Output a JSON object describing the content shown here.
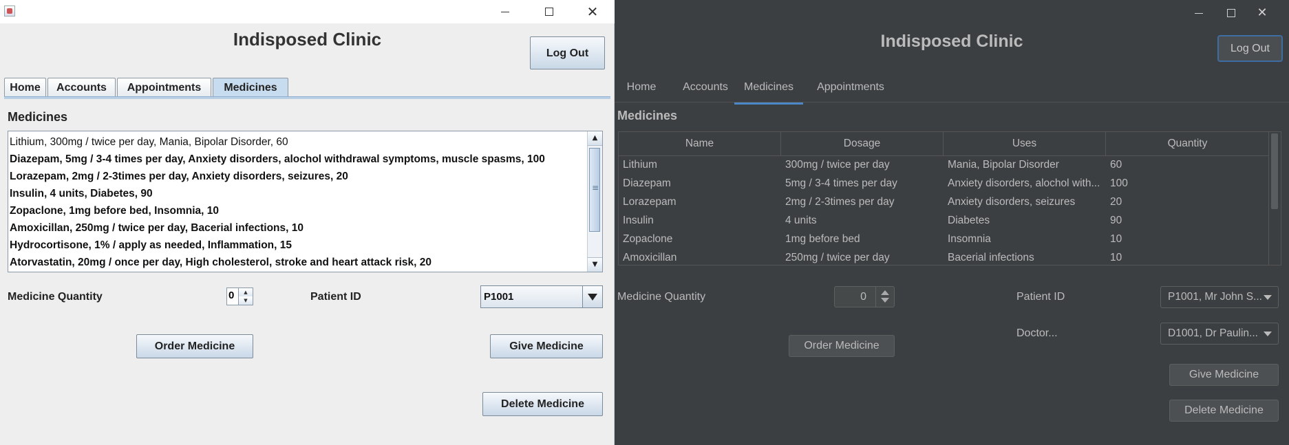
{
  "light_window": {
    "title": "Indisposed Clinic",
    "logout_label": "Log Out",
    "tabs": [
      {
        "label": "Home"
      },
      {
        "label": "Accounts"
      },
      {
        "label": "Appointments"
      },
      {
        "label": "Medicines"
      }
    ],
    "active_tab": "Medicines",
    "section_title": "Medicines",
    "medicines_list": [
      "Lithium, 300mg / twice per day, Mania, Bipolar Disorder, 60",
      "Diazepam, 5mg / 3-4 times per day, Anxiety disorders, alochol withdrawal symptoms, muscle spasms, 100",
      "Lorazepam, 2mg / 2-3times per day, Anxiety disorders, seizures, 20",
      "Insulin, 4 units, Diabetes, 90",
      "Zopaclone, 1mg before bed, Insomnia, 10",
      "Amoxicillan, 250mg / twice per day, Bacerial infections, 10",
      "Hydrocortisone, 1% / apply as needed, Inflammation, 15",
      "Atorvastatin, 20mg / once per day, High cholesterol, stroke and heart attack risk, 20"
    ],
    "quantity_label": "Medicine Quantity",
    "quantity_value": "0",
    "patient_label": "Patient ID",
    "patient_value": "P1001",
    "order_button": "Order Medicine",
    "give_button": "Give Medicine",
    "delete_button": "Delete Medicine"
  },
  "dark_window": {
    "title": "Indisposed Clinic",
    "logout_label": "Log Out",
    "tabs": [
      {
        "label": "Home"
      },
      {
        "label": "Accounts"
      },
      {
        "label": "Medicines"
      },
      {
        "label": "Appointments"
      }
    ],
    "active_tab": "Medicines",
    "section_title": "Medicines",
    "table": {
      "columns": [
        "Name",
        "Dosage",
        "Uses",
        "Quantity"
      ],
      "rows": [
        {
          "name": "Lithium",
          "dosage": "300mg / twice per day",
          "uses": "Mania, Bipolar Disorder",
          "quantity": "60"
        },
        {
          "name": "Diazepam",
          "dosage": "5mg / 3-4 times per day",
          "uses": "Anxiety disorders, alochol with...",
          "quantity": "100"
        },
        {
          "name": "Lorazepam",
          "dosage": "2mg / 2-3times per day",
          "uses": "Anxiety disorders, seizures",
          "quantity": "20"
        },
        {
          "name": "Insulin",
          "dosage": "4 units",
          "uses": "Diabetes",
          "quantity": "90"
        },
        {
          "name": "Zopaclone",
          "dosage": "1mg before bed",
          "uses": "Insomnia",
          "quantity": "10"
        },
        {
          "name": "Amoxicillan",
          "dosage": "250mg / twice per day",
          "uses": "Bacerial infections",
          "quantity": "10"
        }
      ]
    },
    "quantity_label": "Medicine Quantity",
    "quantity_value": "0",
    "patient_label": "Patient ID",
    "patient_value": "P1001, Mr John S...",
    "doctor_label": "Doctor...",
    "doctor_value": "D1001, Dr Paulin...",
    "order_button": "Order Medicine",
    "give_button": "Give Medicine",
    "delete_button": "Delete Medicine"
  },
  "colors": {
    "light_bg": "#eeeeee",
    "light_accent": "#c8dcef",
    "dark_bg": "#3c3f41",
    "dark_text": "#bbbbbb",
    "dark_accent": "#4a88c7"
  }
}
